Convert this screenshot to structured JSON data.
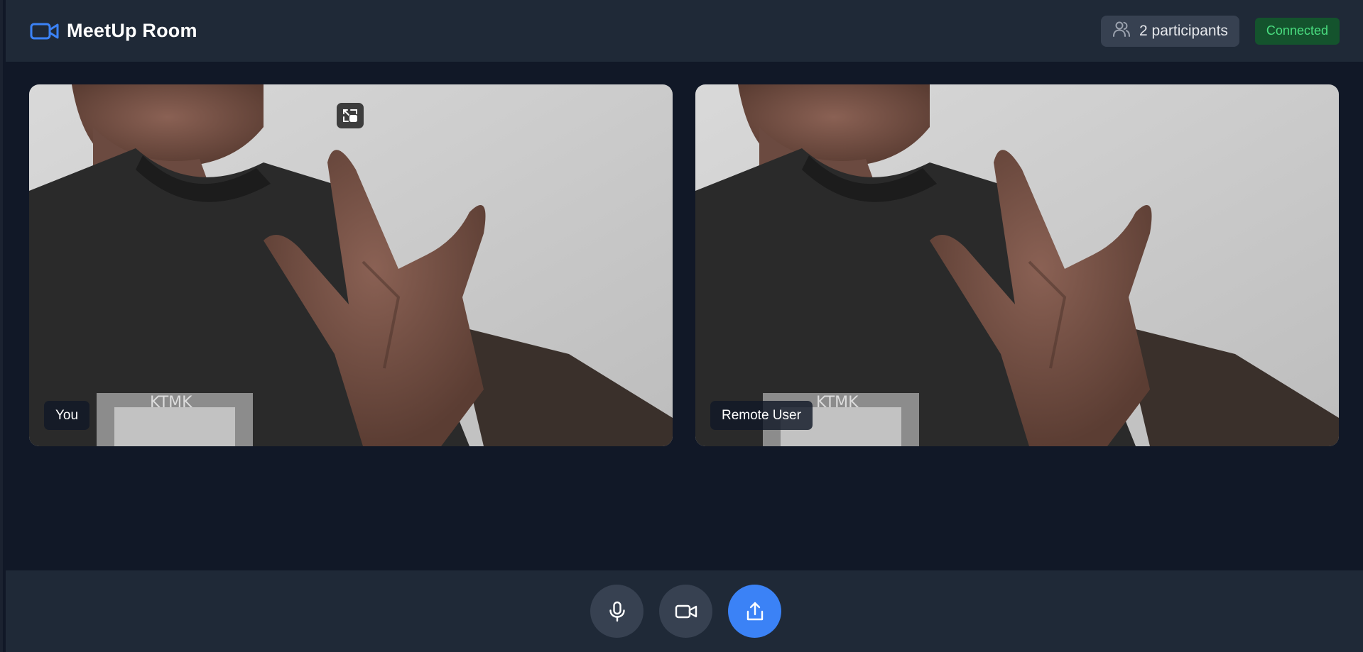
{
  "app": {
    "title": "MeetUp Room",
    "brand_icon": "video-camera-icon"
  },
  "header": {
    "participants_icon": "users-icon",
    "participants_label": "2 participants",
    "status": "Connected",
    "status_color": "#4ade80"
  },
  "videos": {
    "local": {
      "label": "You",
      "pip_icon": "picture-in-picture-icon"
    },
    "remote": {
      "label": "Remote User"
    }
  },
  "controls": [
    {
      "name": "microphone",
      "icon": "microphone-icon"
    },
    {
      "name": "camera",
      "icon": "video-camera-icon"
    },
    {
      "name": "share-screen",
      "icon": "share-upload-icon",
      "active": true
    }
  ],
  "colors": {
    "accent": "#3b82f6",
    "header_bg": "#1f2937",
    "main_bg": "#111827",
    "button_bg": "#374151"
  }
}
